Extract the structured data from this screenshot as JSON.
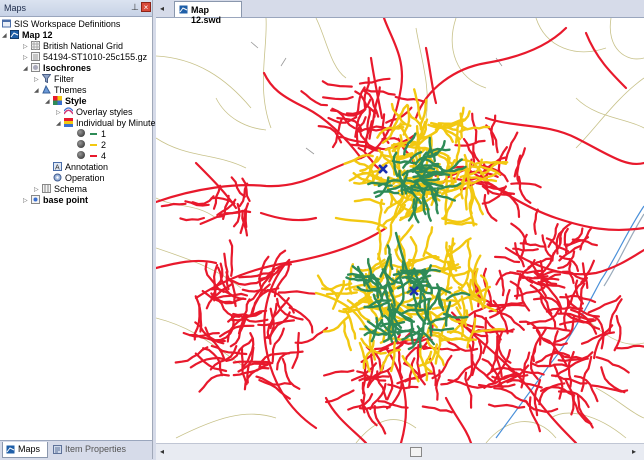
{
  "maps_panel": {
    "title": "Maps",
    "tree": {
      "root": "SIS Workspace Definitions",
      "map": "Map 12",
      "grid": "British National Grid",
      "dataset": "54194-ST1010-25c155.gz",
      "isochrones": "Isochrones",
      "filter": "Filter",
      "themes": "Themes",
      "style": "Style",
      "overlay_styles": "Overlay styles",
      "individual": "Individual by Minutes",
      "legend": [
        {
          "label": "1",
          "color": "#2e8b57"
        },
        {
          "label": "2",
          "color": "#f2c811"
        },
        {
          "label": "4",
          "color": "#e8192c"
        }
      ],
      "annotation": "Annotation",
      "operation": "Operation",
      "schema": "Schema",
      "base_point": "base point"
    },
    "tabs": [
      "Maps",
      "Item Properties"
    ]
  },
  "document": {
    "tab": "Map 12.swd"
  },
  "colors": {
    "zone_1": "#2e8b57",
    "zone_2": "#f2c811",
    "zone_4": "#e8192c",
    "base_point": "#1a2fb0",
    "minor_roads": "#c8c28a",
    "railway": "#4a90d9"
  }
}
